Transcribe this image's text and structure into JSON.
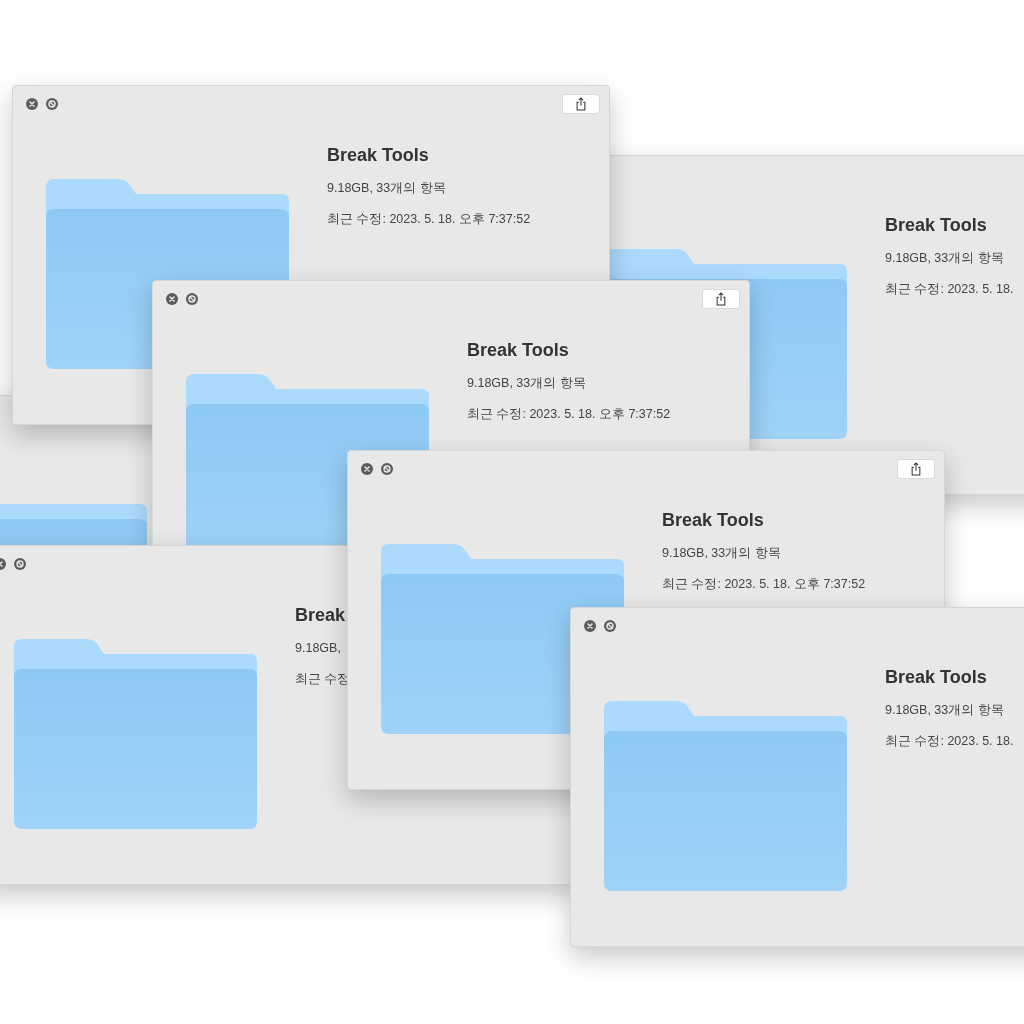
{
  "windows": [
    {
      "title": "Break Tools",
      "summary": "9.18GB, 33개의 항목",
      "modified": "최근 수정: 2023. 5. 18."
    },
    {
      "kind": "folder-only"
    },
    {
      "title": "Break Tools",
      "summary": "9.18GB, 33개의 항목",
      "modified": "최근 수정: 2023. 5. 18. 오후 7:37:52"
    },
    {
      "title": "Break Tools",
      "summary": "9.18GB, 33개의 항목",
      "modified": "최근 수정: 2023. 5. 18. 오후 7:37:52"
    },
    {
      "title": "Break",
      "summary": "9.18GB,",
      "modified": "최근 수정"
    },
    {
      "title": "Break Tools",
      "summary": "9.18GB, 33개의 항목",
      "modified": "최근 수정: 2023. 5. 18. 오후 7:37:52"
    },
    {
      "title": "Break Tools",
      "summary": "9.18GB, 33개의 항목",
      "modified": "최근 수정: 2023. 5. 18."
    }
  ]
}
